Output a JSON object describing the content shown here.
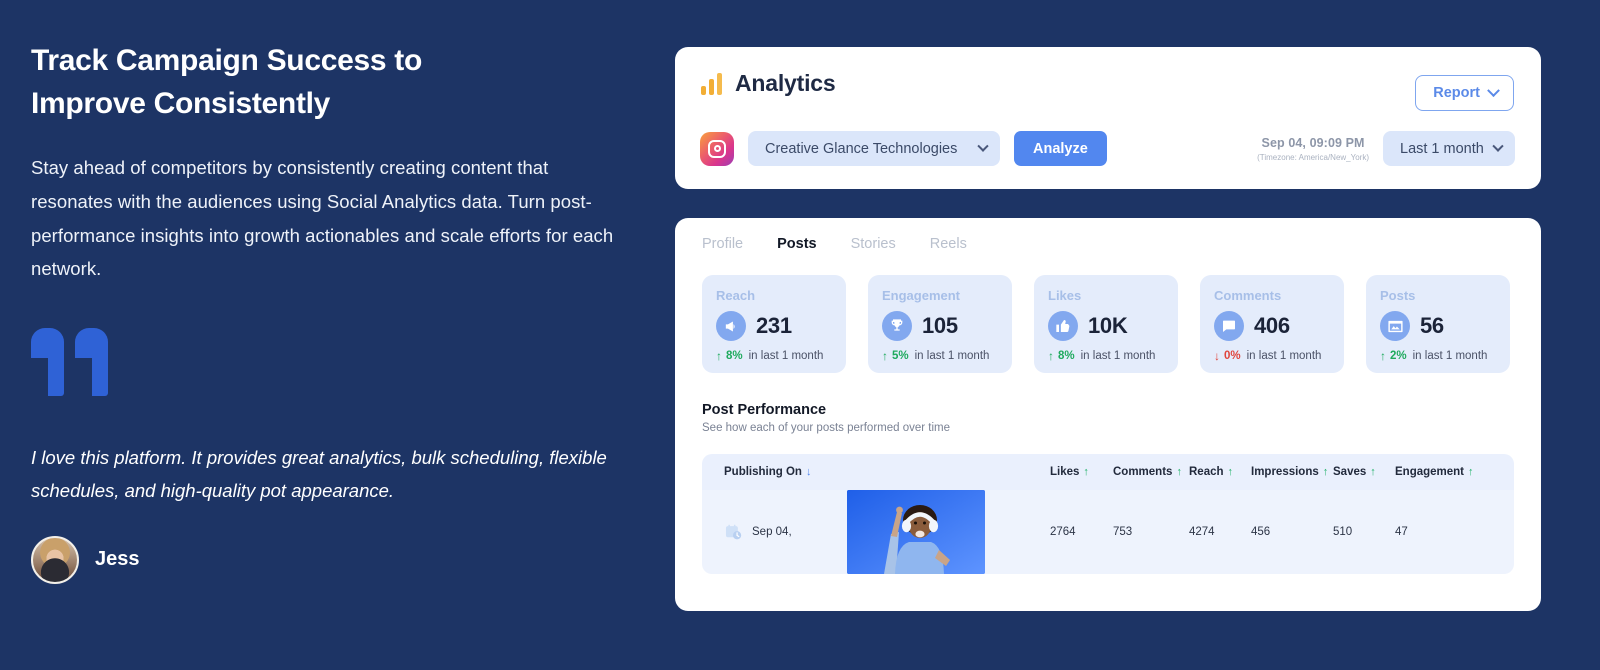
{
  "hero": {
    "headline_line1": "Track Campaign Success to",
    "headline_line2": "Improve Consistently",
    "body": "Stay ahead of competitors by consistently creating content that resonates with the audiences using Social Analytics data. Turn post-performance insights into growth actionables and scale efforts for each network.",
    "quote": "I love this platform. It provides great analytics, bulk scheduling, flexible schedules, and high-quality pot appearance.",
    "author": "Jess"
  },
  "header": {
    "title": "Analytics",
    "report_label": "Report",
    "profile_selected": "Creative Glance Technologies",
    "analyze_label": "Analyze",
    "datetime": "Sep 04, 09:09 PM",
    "timezone": "(Timezone: America/New_York)",
    "range_selected": "Last 1 month"
  },
  "tabs": [
    {
      "label": "Profile",
      "active": false
    },
    {
      "label": "Posts",
      "active": true
    },
    {
      "label": "Stories",
      "active": false
    },
    {
      "label": "Reels",
      "active": false
    }
  ],
  "metrics": [
    {
      "label": "Reach",
      "value": "231",
      "icon": "megaphone-icon",
      "pct": "8%",
      "direction": "up",
      "note": "in last 1 month"
    },
    {
      "label": "Engagement",
      "value": "105",
      "icon": "trophy-icon",
      "pct": "5%",
      "direction": "up",
      "note": "in last 1 month"
    },
    {
      "label": "Likes",
      "value": "10K",
      "icon": "thumbs-up-icon",
      "pct": "8%",
      "direction": "up",
      "note": "in last 1 month"
    },
    {
      "label": "Comments",
      "value": "406",
      "icon": "comment-icon",
      "pct": "0%",
      "direction": "down",
      "note": "in last 1 month"
    },
    {
      "label": "Posts",
      "value": "56",
      "icon": "image-icon",
      "pct": "2%",
      "direction": "up",
      "note": "in last 1 month"
    }
  ],
  "post_performance": {
    "title": "Post Performance",
    "subtitle": "See how each of your posts performed over time",
    "columns": [
      {
        "label": "Publishing On",
        "sort": "down"
      },
      {
        "label": "",
        "sort": ""
      },
      {
        "label": "Likes",
        "sort": "up"
      },
      {
        "label": "Comments",
        "sort": "up"
      },
      {
        "label": "Reach",
        "sort": "up"
      },
      {
        "label": "Impressions",
        "sort": "up"
      },
      {
        "label": "Saves",
        "sort": "up"
      },
      {
        "label": "Engagement",
        "sort": "up"
      }
    ],
    "rows": [
      {
        "published_on": "Sep 04,",
        "likes": "2764",
        "comments": "753",
        "reach": "4274",
        "impressions": "456",
        "saves": "510",
        "engagement": "47"
      }
    ]
  },
  "colors": {
    "page_bg": "#1d3465",
    "accent_blue": "#5287ef",
    "quote_blue": "#2f62d6",
    "logo_orange": "#f2ae35",
    "metric_bg": "#e4ecfb",
    "up_green": "#1faa5e",
    "down_red": "#e0453c"
  }
}
